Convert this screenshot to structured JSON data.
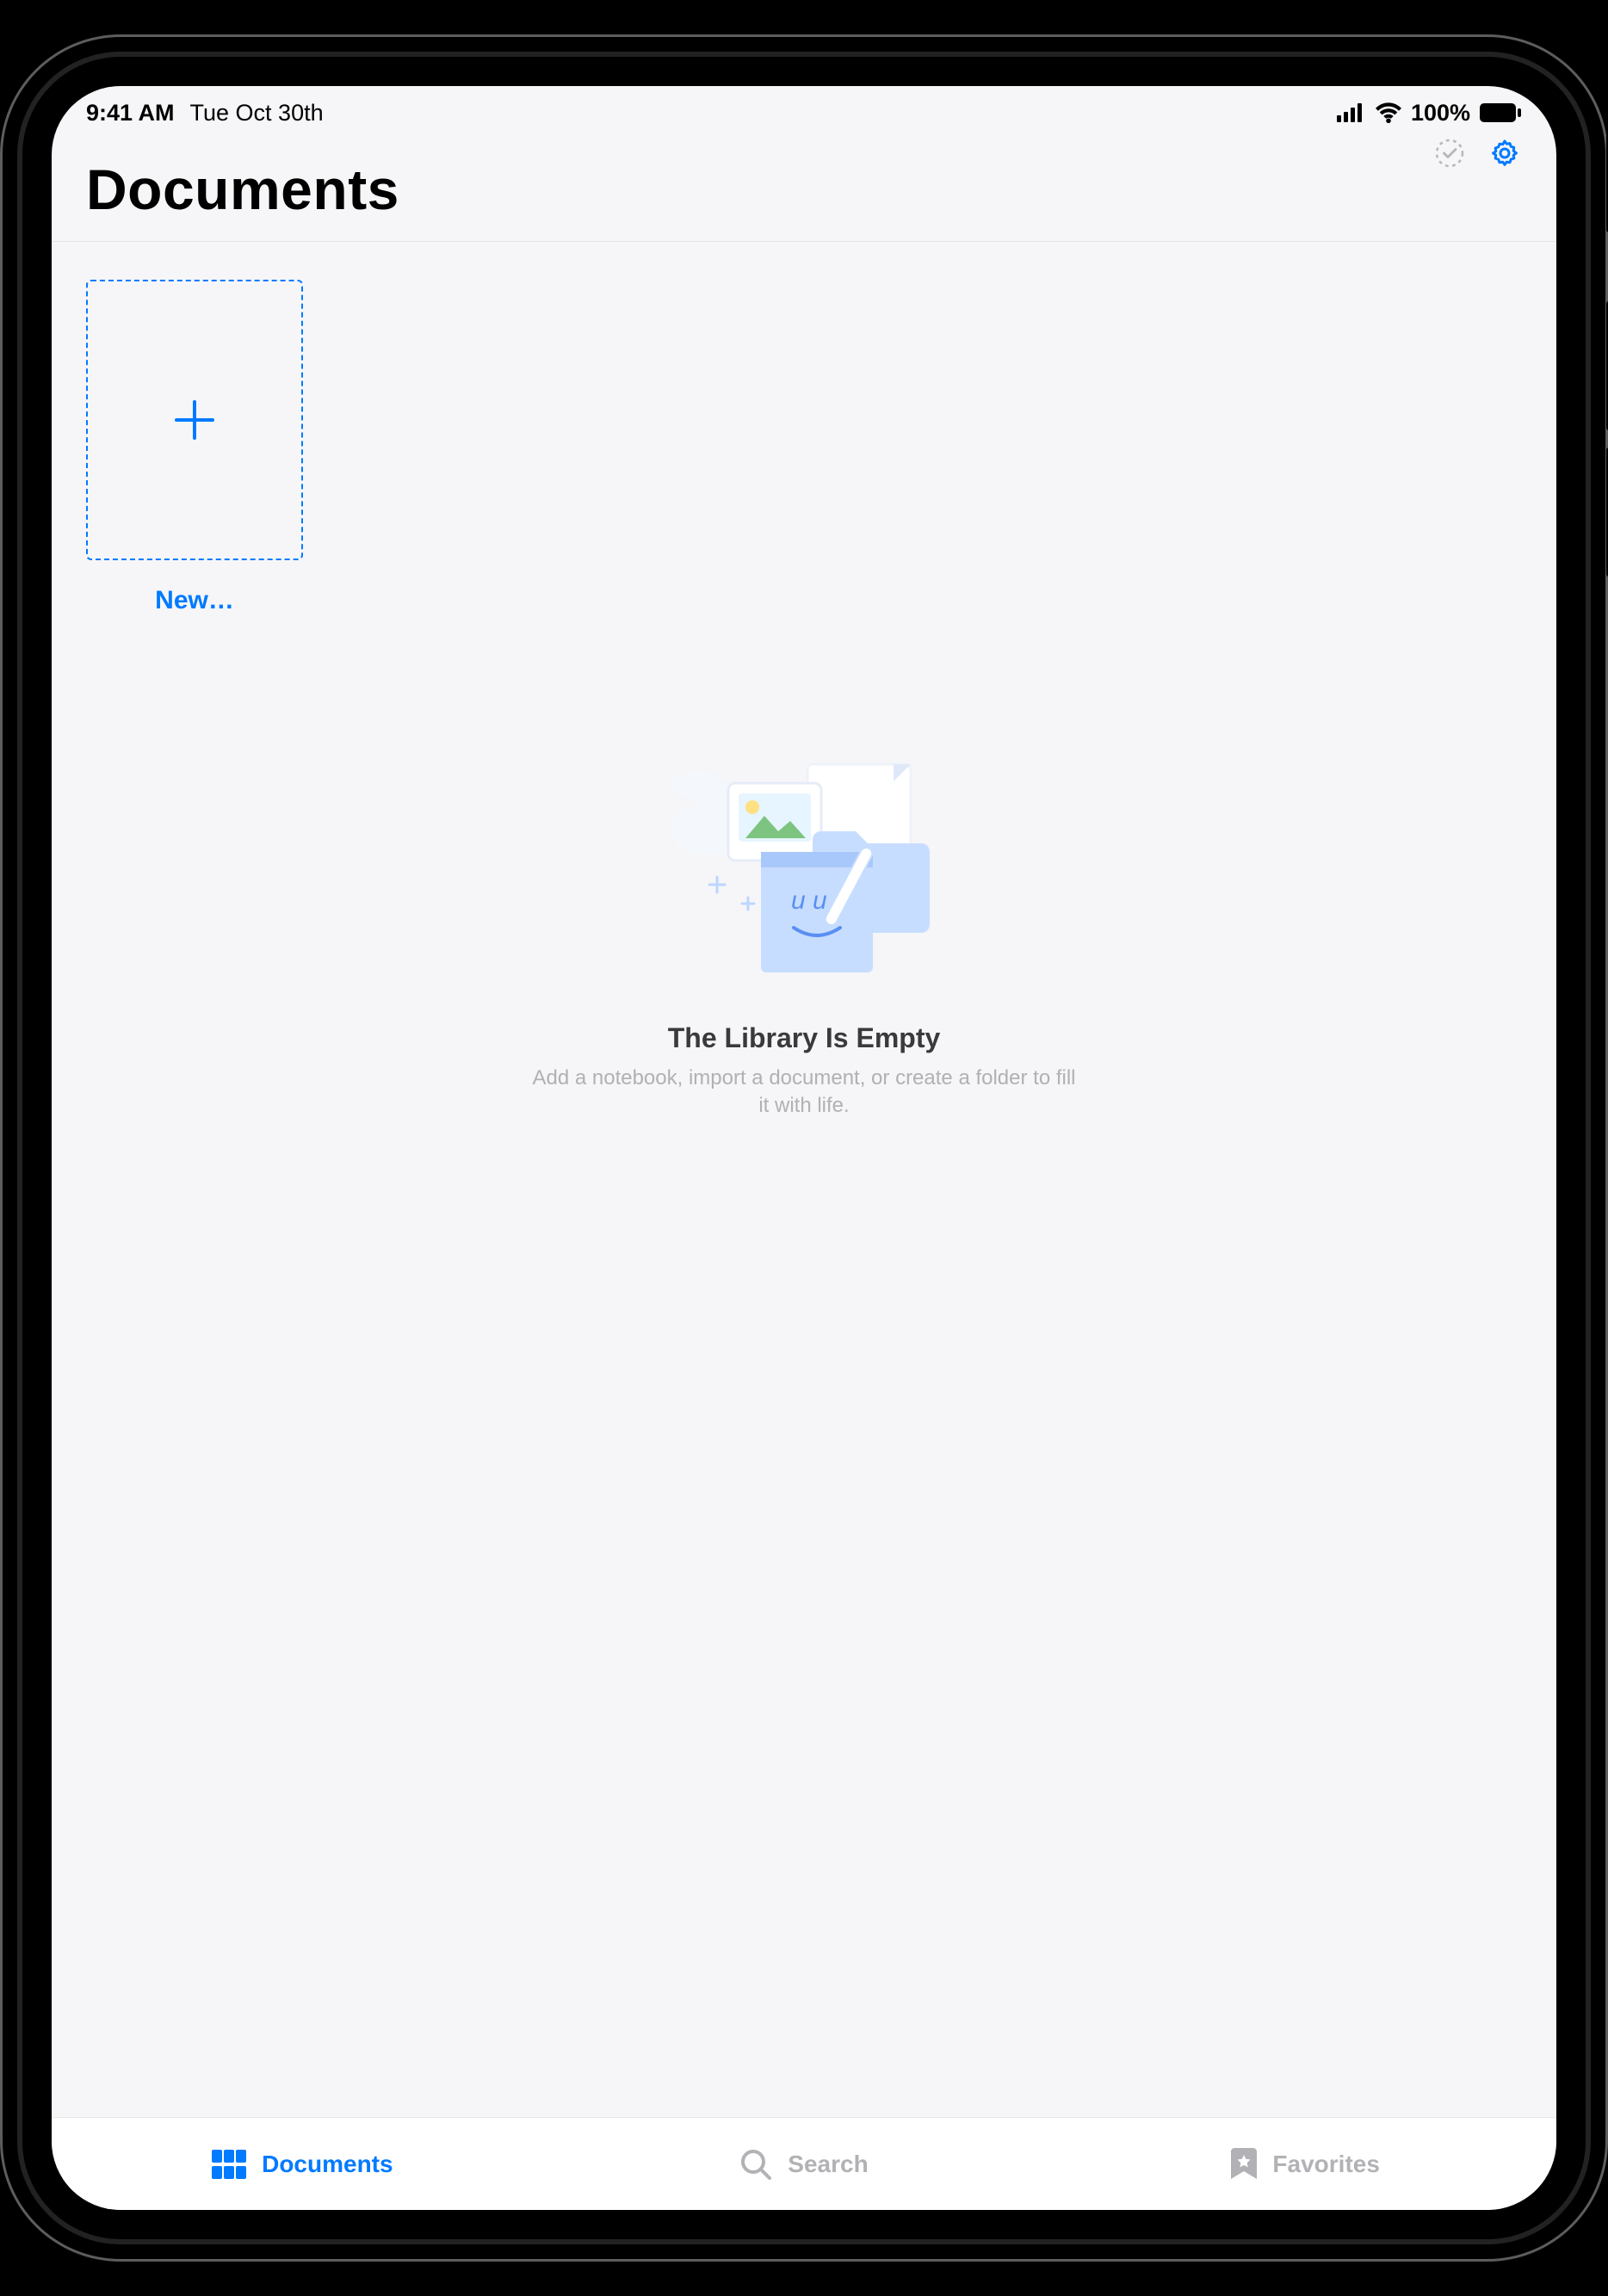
{
  "status": {
    "time": "9:41 AM",
    "date": "Tue Oct 30th",
    "battery_pct": "100%"
  },
  "header": {
    "title": "Documents"
  },
  "new_tile": {
    "label": "New…"
  },
  "empty": {
    "title": "The Library Is Empty",
    "subtitle": "Add a notebook, import a document, or create a folder to fill it with life."
  },
  "tabs": {
    "documents": "Documents",
    "search": "Search",
    "favorites": "Favorites"
  }
}
